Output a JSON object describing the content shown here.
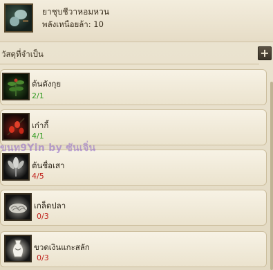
{
  "header": {
    "item_name": "ยาชุบชีวาหอมหวน",
    "stat_text": "พลังเหนือยล้า: 10",
    "icon": "potion-icon"
  },
  "section": {
    "title": "วัสดุที่จำเป็น",
    "add_button_label": "+"
  },
  "materials": [
    {
      "name": "ต้นตังกุย",
      "count": "2/1",
      "icon": "herb-plant-icon",
      "status_color": "#2e9a1e"
    },
    {
      "name": "เก๋ากี้",
      "count": "4/1",
      "icon": "goji-berry-icon",
      "status_color": "#2e9a1e"
    },
    {
      "name": "ต้นชื่อเสา",
      "count": "4/5",
      "icon": "flower-icon",
      "status_color": "#c0201a"
    },
    {
      "name": "เกล็ดปลา",
      "count": "0/3",
      "icon": "fish-scale-icon",
      "status_color": "#c0201a"
    },
    {
      "name": "ขวดเงินแกะสลัก",
      "count": "0/3",
      "icon": "silver-vase-icon",
      "status_color": "#c0201a"
    }
  ],
  "watermark": "ขนท9Yin by ซันเจิ่น"
}
